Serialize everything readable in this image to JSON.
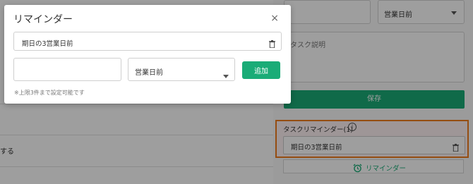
{
  "background": {
    "left_fragment_1": "",
    "left_fragment_2": "する",
    "right_select_value": "営業日前",
    "task_description_placeholder": "タスク説明",
    "save_label": "保存",
    "task_reminder_heading": "タスクリマインダー(1)",
    "info_icon_glyph": "i",
    "task_reminder_item": "期日の3営業日前",
    "reminder_button_label": "リマインダー",
    "highlight_color": "#f07c1c",
    "accent_color": "#1aac77"
  },
  "modal": {
    "title": "リマインダー",
    "close_glyph": "×",
    "existing_reminder": "期日の3営業日前",
    "days_input_value": "",
    "days_input_placeholder": "",
    "unit_select_value": "営業日前",
    "add_label": "追加",
    "note": "※上限3件まで設定可能です"
  },
  "icons": {
    "trash": "trash-icon",
    "caret": "chevron-down-icon",
    "close": "close-icon",
    "alarm": "alarm-clock-icon",
    "info": "info-icon"
  }
}
